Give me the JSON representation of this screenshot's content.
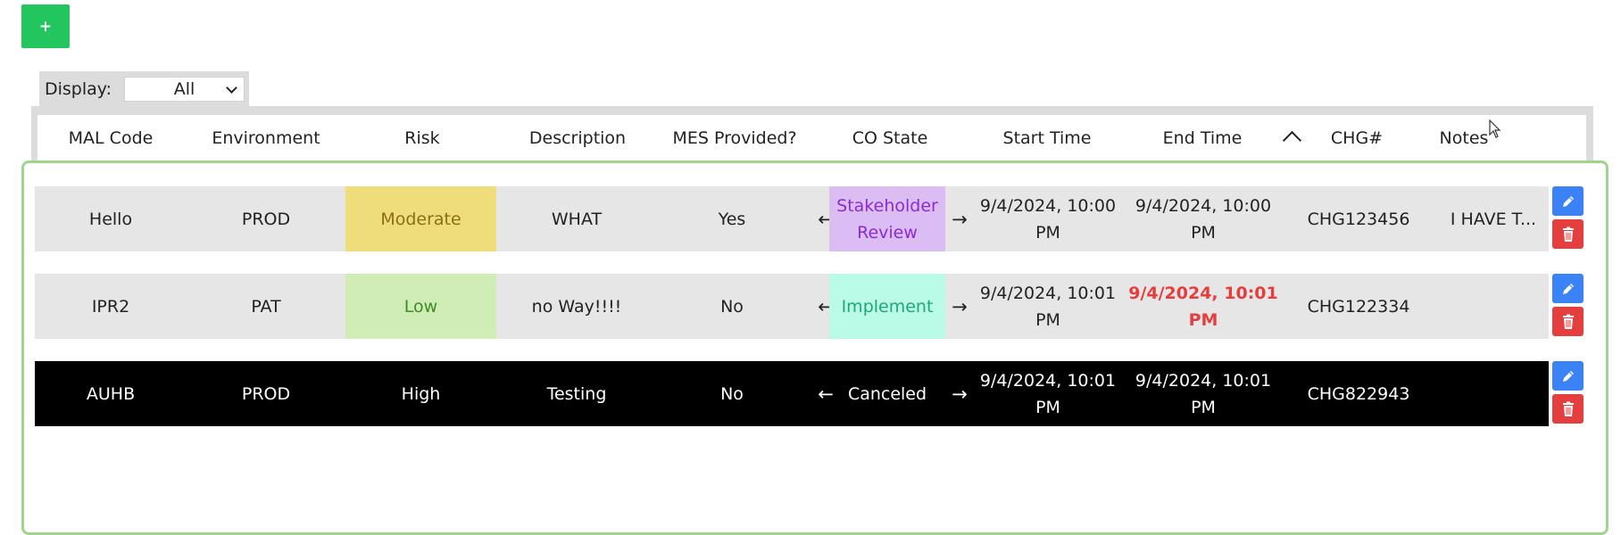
{
  "toolbar": {
    "add_label": "+"
  },
  "filter": {
    "label": "Display:",
    "value": "All"
  },
  "table": {
    "headers": [
      "MAL Code",
      "Environment",
      "Risk",
      "Description",
      "MES Provided?",
      "CO State",
      "Start Time",
      "End Time",
      "CHG#",
      "Notes"
    ],
    "rows": [
      {
        "mal_code": "Hello",
        "environment": "PROD",
        "risk": "Moderate",
        "description": "WHAT",
        "mes_provided": "Yes",
        "co_state": "Stakeholder Review",
        "start_time": "9/4/2024, 10:00 PM",
        "end_time": "9/4/2024, 10:00 PM",
        "chg": "CHG123456",
        "notes": "I HAVE T..."
      },
      {
        "mal_code": "IPR2",
        "environment": "PAT",
        "risk": "Low",
        "description": "no Way!!!!",
        "mes_provided": "No",
        "co_state": "Implement",
        "start_time": "9/4/2024, 10:01 PM",
        "end_time": "9/4/2024, 10:01 PM",
        "chg": "CHG122334",
        "notes": ""
      },
      {
        "mal_code": "AUHB",
        "environment": "PROD",
        "risk": "High",
        "description": "Testing",
        "mes_provided": "No",
        "co_state": "Canceled",
        "start_time": "9/4/2024, 10:01 PM",
        "end_time": "9/4/2024, 10:01 PM",
        "chg": "CHG822943",
        "notes": ""
      }
    ]
  },
  "arrows": {
    "left": "←",
    "right": "→"
  },
  "colors": {
    "add_button": "#22c55e",
    "moderate_risk": "#efdc7a",
    "low_risk": "#d0edb5",
    "stakeholder_review": "#dcbdf3",
    "implement": "#b9fbe6",
    "overdue_text": "#e53e3e",
    "edit_button": "#3b82f6",
    "delete_button": "#e53e3e",
    "canceled_row": "#000000"
  },
  "icons": {
    "edit": "pencil-icon",
    "delete": "trash-icon",
    "sort": "chevron-up-icon"
  }
}
